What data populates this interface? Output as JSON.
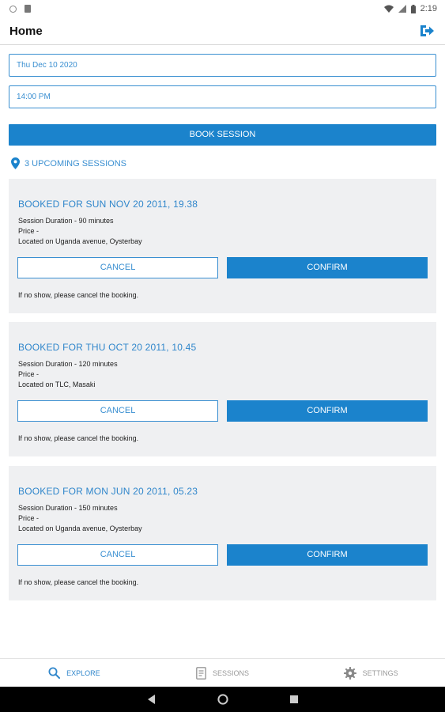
{
  "status_bar": {
    "time": "2:19"
  },
  "app_bar": {
    "title": "Home"
  },
  "form": {
    "date_value": "Thu Dec 10 2020",
    "time_value": "14:00 PM",
    "book_label": "BOOK SESSION"
  },
  "upcoming": {
    "label": "3 UPCOMING SESSIONS"
  },
  "sessions": [
    {
      "title": "BOOKED FOR SUN NOV 20 2011, 19.38",
      "duration": "Session Duration - 90 minutes",
      "price": "Price -",
      "location": "Located on Uganda avenue, Oysterbay",
      "cancel_label": "CANCEL",
      "confirm_label": "CONFIRM",
      "note": "If no show, please cancel the booking."
    },
    {
      "title": "BOOKED FOR THU OCT 20 2011, 10.45",
      "duration": "Session Duration - 120 minutes",
      "price": "Price -",
      "location": "Located on TLC, Masaki",
      "cancel_label": "CANCEL",
      "confirm_label": "CONFIRM",
      "note": "If no show, please cancel the booking."
    },
    {
      "title": "BOOKED FOR MON JUN 20 2011, 05.23",
      "duration": "Session Duration - 150 minutes",
      "price": "Price -",
      "location": "Located on Uganda avenue, Oysterbay",
      "cancel_label": "CANCEL",
      "confirm_label": "CONFIRM",
      "note": "If no show, please cancel the booking."
    }
  ],
  "bottom_nav": {
    "items": [
      {
        "label": "EXPLORE",
        "icon": "search-icon",
        "active": true
      },
      {
        "label": "SESSIONS",
        "icon": "document-icon",
        "active": false
      },
      {
        "label": "SETTINGS",
        "icon": "gear-icon",
        "active": false
      }
    ]
  },
  "colors": {
    "accent": "#1b83cc",
    "accent_text": "#2f86cb",
    "card_background": "#eff0f2"
  }
}
